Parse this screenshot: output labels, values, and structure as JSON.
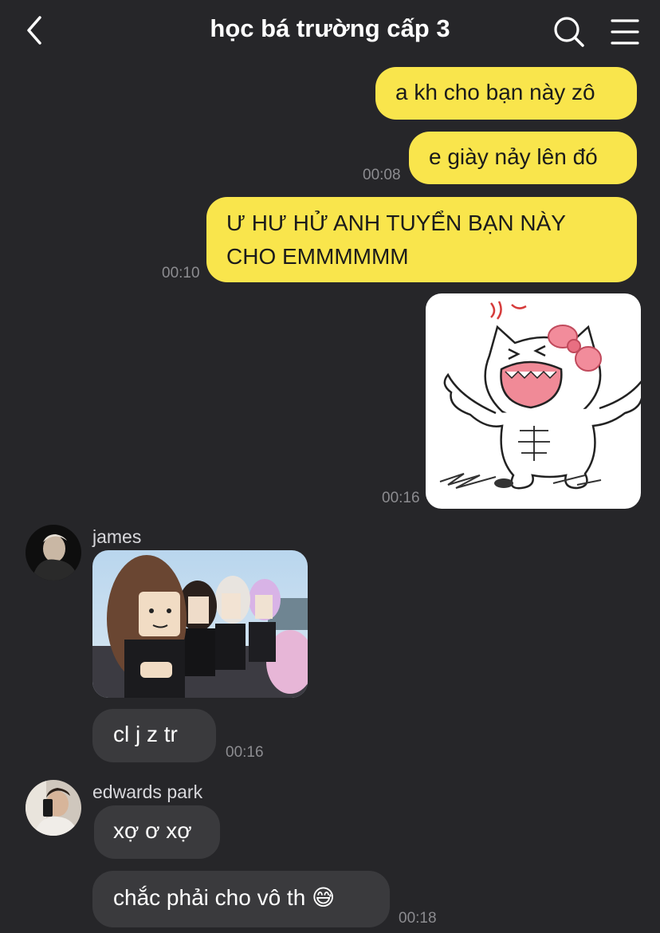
{
  "header": {
    "title": "học bá trường cấp 3",
    "back_icon": "back-arrow-icon",
    "search_icon": "search-icon",
    "menu_icon": "menu-icon"
  },
  "messages": [
    {
      "dir": "out",
      "text": "a kh cho bạn này zô",
      "time": ""
    },
    {
      "dir": "out",
      "text": "e giày nảy lên đó",
      "time": "00:08"
    },
    {
      "dir": "out",
      "text": "Ư HƯ HỬ ANH TUYỂN BẠN NÀY CHO EMMMMMM",
      "time": "00:10"
    },
    {
      "dir": "out",
      "type": "sticker",
      "sticker": "angry-muscular-cat-sticker",
      "time": "00:16"
    },
    {
      "dir": "in",
      "sender": "james",
      "type": "image",
      "image": "roblox-characters-photo",
      "time": ""
    },
    {
      "dir": "in",
      "sender": "james",
      "text": "cl j z tr",
      "time": "00:16"
    },
    {
      "dir": "in",
      "sender": "edwards park",
      "text": "xợ ơ xợ",
      "time": ""
    },
    {
      "dir": "in",
      "sender": "edwards park",
      "text": "chắc phải cho vô th 😅",
      "time": "00:18"
    }
  ],
  "colors": {
    "background": "#262629",
    "outgoing_bubble": "#f9e54c",
    "incoming_bubble": "#3a3a3d",
    "timestamp": "#8c8c90"
  }
}
